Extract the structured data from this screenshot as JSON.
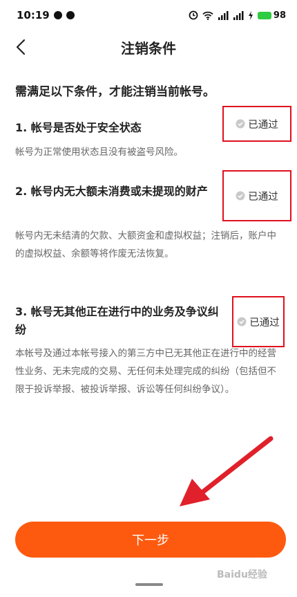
{
  "status_bar": {
    "time": "10:19",
    "battery": "98",
    "icons": [
      "chat-bubble-icon",
      "chat-bubble-icon",
      "alarm-icon",
      "wifi-icon",
      "signal-icon",
      "signal-icon",
      "charging-icon",
      "battery-icon"
    ]
  },
  "header": {
    "title": "注销条件",
    "back_icon": "chevron-left-icon"
  },
  "intro": "需满足以下条件，才能注销当前帐号。",
  "conditions": [
    {
      "title": "1. 帐号是否处于安全状态",
      "desc": "帐号为正常使用状态且没有被盗号风险。",
      "status": "已通过"
    },
    {
      "title": "2. 帐号内无大额未消费或未提现的财产",
      "desc": "帐号内无未结清的欠款、大额资金和虚拟权益；注销后，账户中的虚拟权益、余额等将作废无法恢复。",
      "status": "已通过"
    },
    {
      "title": "3. 帐号无其他正在进行中的业务及争议纠纷",
      "desc": "本帐号及通过本帐号接入的第三方中已无其他正在进行中的经营性业务、无未完成的交易、无任何未处理完成的纠纷（包括但不限于投诉举报、被投诉举报、诉讼等任何纠纷争议）。",
      "status": "已通过"
    }
  ],
  "next_button": "下一步",
  "watermark": "Baidu经验",
  "colors": {
    "accent": "#fe5a0f",
    "highlight_border": "#e0101c",
    "arrow": "#e0202a"
  }
}
